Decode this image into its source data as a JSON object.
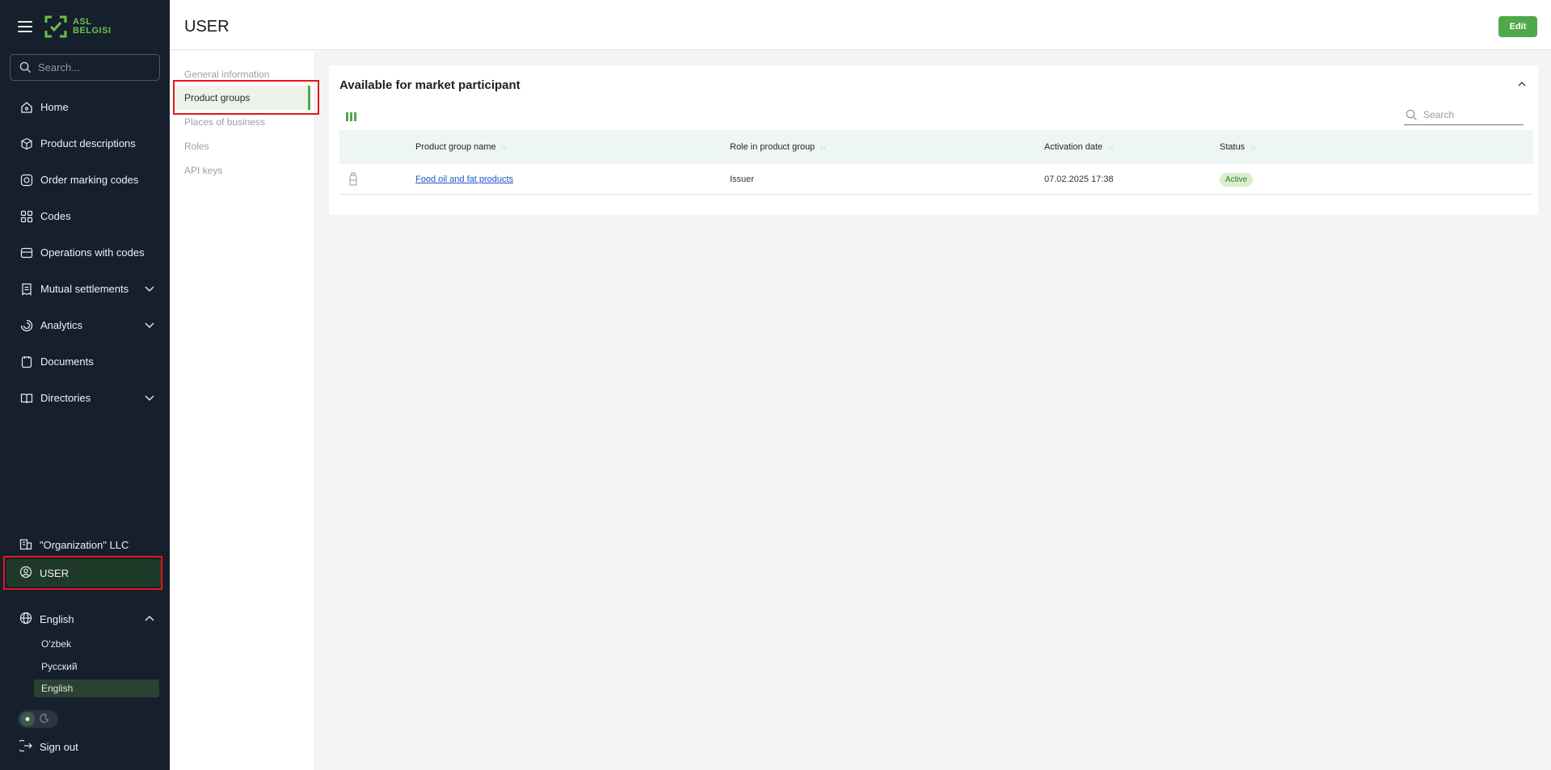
{
  "sidebar": {
    "logo_line1": "ASL",
    "logo_line2": "BELGISI",
    "search_placeholder": "Search...",
    "items": [
      {
        "label": "Home",
        "icon": "home-icon"
      },
      {
        "label": "Product descriptions",
        "icon": "box-icon"
      },
      {
        "label": "Order marking codes",
        "icon": "qr-order-icon"
      },
      {
        "label": "Codes",
        "icon": "codes-icon"
      },
      {
        "label": "Operations with codes",
        "icon": "operations-icon"
      },
      {
        "label": "Mutual settlements",
        "icon": "receipt-icon",
        "expandable": true
      },
      {
        "label": "Analytics",
        "icon": "analytics-icon",
        "expandable": true
      },
      {
        "label": "Documents",
        "icon": "document-icon"
      },
      {
        "label": "Directories",
        "icon": "book-icon",
        "expandable": true
      }
    ],
    "organization": "\"Organization\" LLC",
    "user": "USER",
    "language": "English",
    "languages": [
      "O'zbek",
      "Русский",
      "English"
    ],
    "sign_out": "Sign out"
  },
  "header": {
    "title": "USER",
    "edit_label": "Edit"
  },
  "subnav": {
    "items": [
      "General information",
      "Product groups",
      "Places of business",
      "Roles",
      "API keys"
    ],
    "active": "Product groups"
  },
  "card": {
    "title": "Available for market participant",
    "search_placeholder": "Search",
    "columns": [
      "Product group name",
      "Role in product group",
      "Activation date",
      "Status"
    ],
    "rows": [
      {
        "name": "Food oil and fat products",
        "role": "Issuer",
        "date": "07.02.2025 17:38",
        "status": "Active"
      }
    ]
  },
  "colors": {
    "sidebar_bg": "#15202c",
    "accent_green": "#4fa84a",
    "highlight_red": "#e5141b",
    "link_blue": "#1f55c8"
  }
}
